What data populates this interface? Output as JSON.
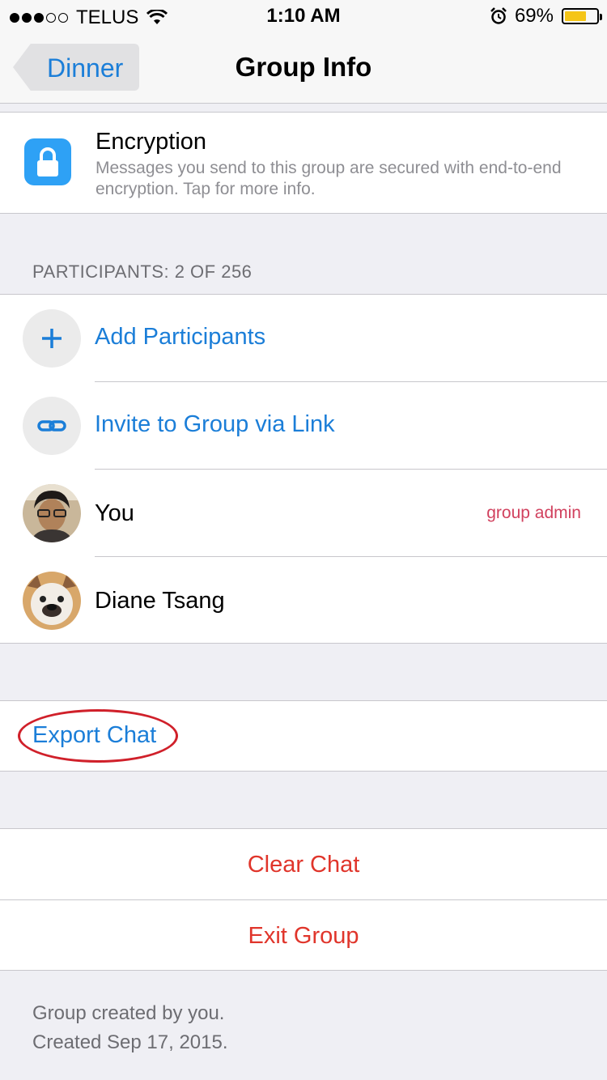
{
  "status_bar": {
    "carrier": "TELUS",
    "time": "1:10 AM",
    "battery": "69%",
    "battery_level": 0.69,
    "signal_icon": "signal-dots-icon",
    "wifi_icon": "wifi-icon",
    "alarm_icon": "alarm-clock-icon"
  },
  "nav": {
    "back_label": "Dinner",
    "title": "Group Info"
  },
  "encryption": {
    "icon": "lock-icon",
    "title": "Encryption",
    "description": "Messages you send to this group are secured with end-to-end encryption. Tap for more info."
  },
  "participants": {
    "header": "PARTICIPANTS: 2 OF 256",
    "add_label": "Add Participants",
    "invite_label": "Invite to Group via Link",
    "members": [
      {
        "name": "You",
        "badge": "group admin"
      },
      {
        "name": "Diane Tsang",
        "badge": ""
      }
    ]
  },
  "export": {
    "label": "Export Chat"
  },
  "actions": {
    "clear_label": "Clear Chat",
    "exit_label": "Exit Group"
  },
  "footer": {
    "created_by": "Group created by you.",
    "created_on": "Created Sep 17, 2015."
  },
  "colors": {
    "link_blue": "#1b7ed8",
    "destructive_red": "#e0352b",
    "admin_pink": "#d1415e",
    "annotation_red": "#d0202a"
  }
}
